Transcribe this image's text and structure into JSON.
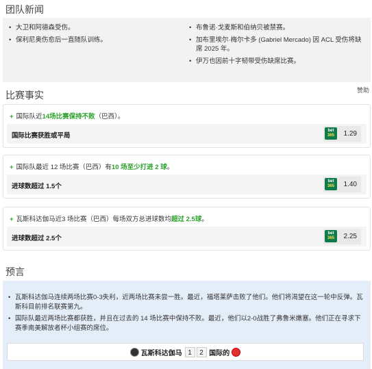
{
  "team_news": {
    "title": "团队新闻",
    "left": [
      "大卫和阿德森受伤。",
      "保利尼奥伤愈后一直随队训练。"
    ],
    "right": [
      "布鲁诺·戈麦斯和伯纳贝被禁赛。",
      "加布里埃尔·梅尔卡多 (Gabriel Mercado) 因 ACL 受伤将缺席 2025 年。",
      "伊万也因前十字韧带受伤缺席比赛。"
    ]
  },
  "facts": {
    "title": "比赛事实",
    "sponsor": "赞助",
    "cards": [
      {
        "pre": "国际队近",
        "hl1": "14场比赛保持",
        "hl2": "不败",
        "post": "（巴西）。",
        "bet_label": "国际比赛获胜或平局",
        "bookmaker_top": "bet",
        "bookmaker_bottom": "365",
        "odds": "1.29"
      },
      {
        "pre": "国际队最近 12 场比赛（巴西）有",
        "hl1": "10 场至少打进 2 球",
        "hl2": "",
        "post": "。",
        "bet_label": "进球数超过 1.5个",
        "bookmaker_top": "bet",
        "bookmaker_bottom": "365",
        "odds": "1.40"
      },
      {
        "pre": "瓦斯科达伽马近3 场比赛（巴西）每场双方总进球数均",
        "hl1": "超过 2.5球",
        "hl2": "",
        "post": "。",
        "bet_label": "进球数超过 2.5个",
        "bookmaker_top": "bet",
        "bookmaker_bottom": "365",
        "odds": "2.25"
      }
    ]
  },
  "prediction": {
    "title": "预言",
    "items": [
      "瓦斯科达伽马连续两场比赛0-3失利，近两场比赛未尝一胜。最近，福塔莱萨击败了他们。他们将渴望在这一轮中反弹。瓦斯科目前排名联赛第九。",
      "国际队最近两场比赛都获胜，并且在过去的 14 场比赛中保持不败。最近，他们以2-0战胜了弗鲁米嫩塞。他们正在寻求下赛季南美解放者杯小组赛的席位。"
    ],
    "home_team": "瓦斯科达伽马",
    "home_score": "1",
    "away_score": "2",
    "away_team": "国际的"
  },
  "colors": {
    "highlight": "#2aa12a",
    "prediction_bg": "#e4eef9",
    "bet365_green": "#0f7a4a"
  }
}
